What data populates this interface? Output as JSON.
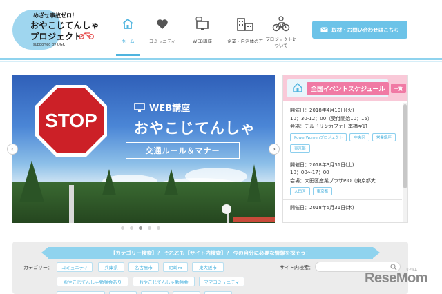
{
  "colors": {
    "accent": "#4fb4df",
    "button": "#6cc3e8",
    "pink": "#f07aa4",
    "header_line": "#8fd3ee"
  },
  "logo": {
    "tagline": "めざせ事故ゼロ！",
    "title_line1": "おやこじてんしゃ",
    "title_line2": "プロジェクト",
    "supported": "supported by OGK",
    "icon": "bicycle-icon"
  },
  "nav": [
    {
      "label": "ホーム",
      "icon": "home-icon",
      "active": true
    },
    {
      "label": "コミュニティ",
      "icon": "heart-icon"
    },
    {
      "label": "WEB講座",
      "icon": "monitor-icon"
    },
    {
      "label": "企業・自治体の方",
      "icon": "building-icon"
    },
    {
      "label": "プロジェクトに\nついて",
      "icon": "family-bicycle-icon"
    }
  ],
  "contact_button": {
    "label": "取材・お問い合わせはこちら",
    "icon": "mail-icon"
  },
  "banner": {
    "sign_text": "STOP",
    "web_label": "WEB講座",
    "title": "おやこじてんしゃ",
    "subtitle": "交通ルール＆マナー",
    "prev": "‹",
    "next": "›",
    "slide_count": 5,
    "active_slide": 3
  },
  "events": {
    "title": "全国イベントスケジュール",
    "all_label": "一覧",
    "items": [
      {
        "date": "開催日：2018年4月10日(火)",
        "time": "10：30-12：00（受付開始10：15）",
        "venue": "会場：チルドリンカフェ日本橋室町",
        "tags": [
          "PowerWomenプロジェクト",
          "中央区",
          "営業講座",
          "東京都"
        ]
      },
      {
        "date": "開催日：2018年3月31日(土)",
        "time": "10：00〜17：00",
        "venue": "会場：大田区産業プラザPIO（東京都大…",
        "tags": [
          "大田区",
          "東京都"
        ]
      },
      {
        "date": "開催日：2018年5月31日(木)",
        "time": "",
        "venue": "",
        "tags": []
      }
    ]
  },
  "search": {
    "ribbon": "【カテゴリー検索】？ それとも【サイト内検索】？ 今の自分に必要な情報を探そう！",
    "category_label": "カテゴリー：",
    "categories_row1": [
      "コミュニティ",
      "兵庫県",
      "名古屋市",
      "尼崎市",
      "東大阪市"
    ],
    "categories_row2": [
      "おやこじてんしゃ勉強会あり",
      "おやこじてんしゃ勉強会",
      "ママコミュニティ"
    ],
    "site_label": "サイト内検索：",
    "site_placeholder": ""
  },
  "watermark": {
    "text": "ReseMom",
    "small": "リセマム"
  }
}
